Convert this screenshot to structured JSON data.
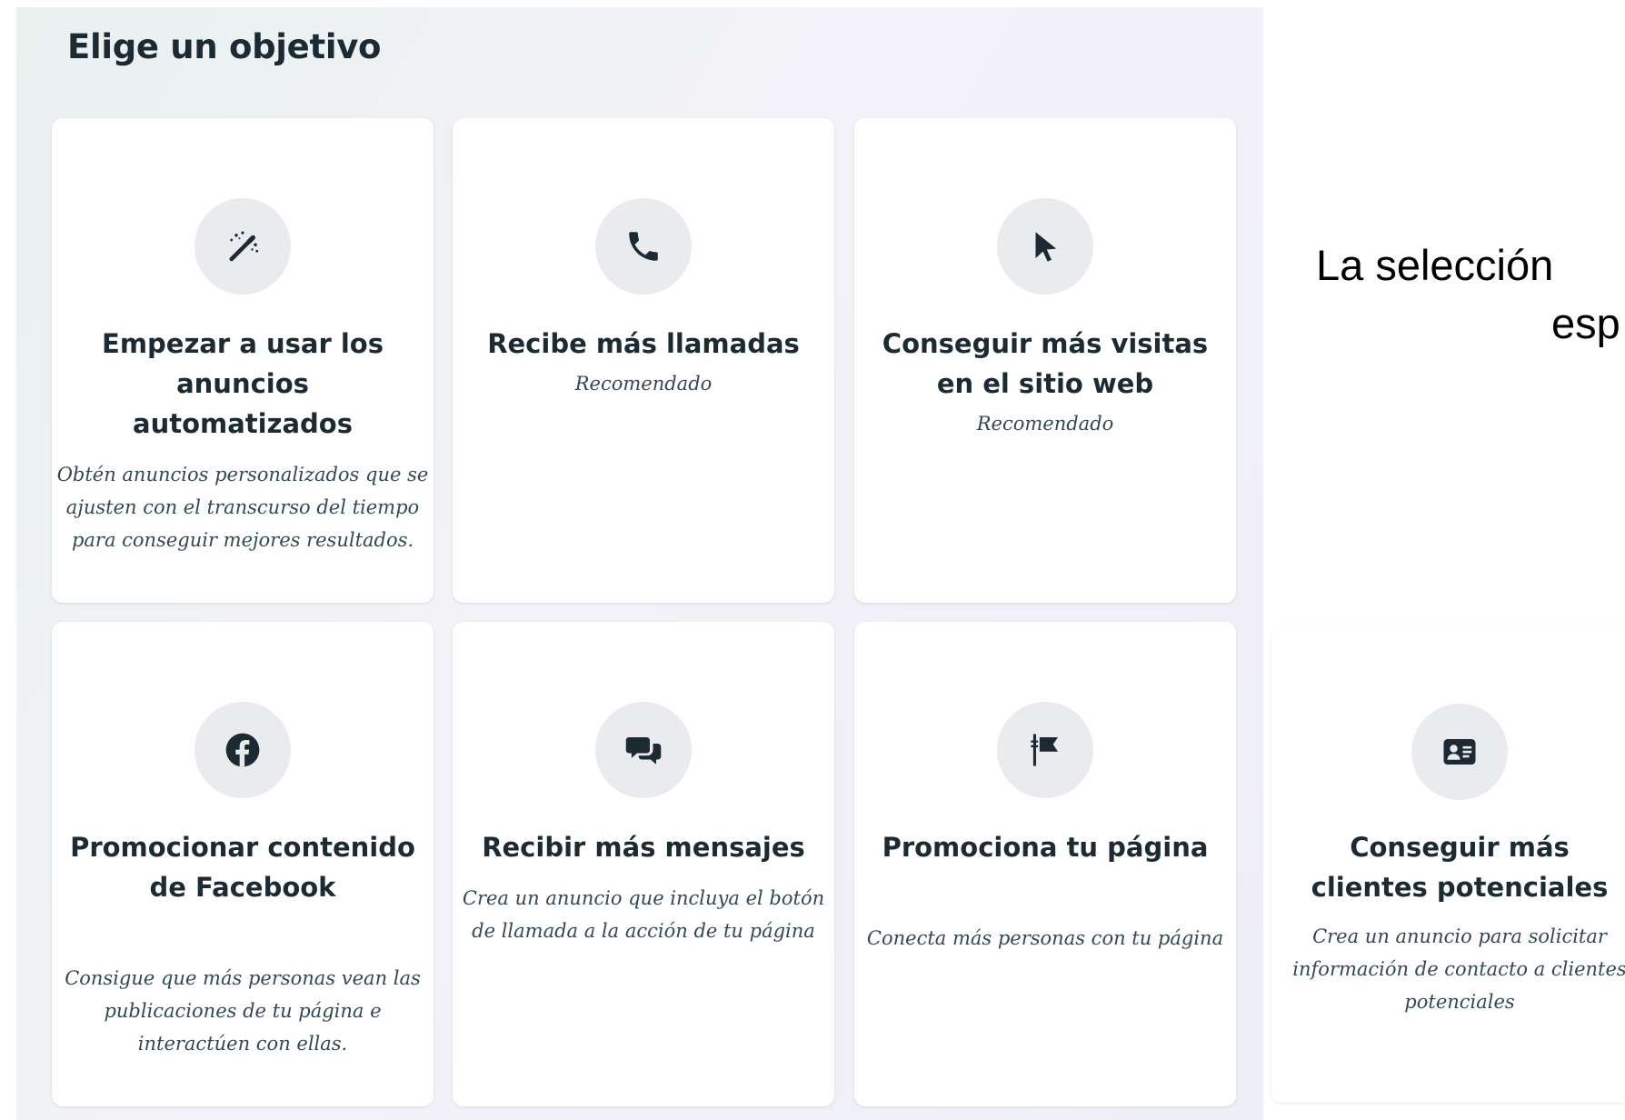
{
  "header": {
    "title": "Elige un objetivo"
  },
  "objectives": [
    {
      "title": "Empezar a usar los anuncios automatizados",
      "description": "Obtén anuncios personalizados que se ajusten con el transcurso del tiempo para conseguir mejores resultados.",
      "icon": "magic-wand-icon"
    },
    {
      "title": "Recibe más llamadas",
      "description": "Recomendado",
      "icon": "phone-icon"
    },
    {
      "title": "Conseguir más visitas en el sitio web",
      "description": "Recomendado",
      "icon": "cursor-icon"
    },
    {
      "title": "Promocionar contenido de Facebook",
      "description": "Consigue que más personas vean las publicaciones de tu página e interactúen con ellas.",
      "icon": "facebook-icon"
    },
    {
      "title": "Recibir más mensajes",
      "description": "Crea un anuncio que incluya el botón de llamada a la acción de tu página",
      "icon": "chat-bubbles-icon"
    },
    {
      "title": "Promociona tu página",
      "description": "Conecta más personas con tu página",
      "icon": "flag-icon"
    },
    {
      "title": "Conseguir más clientes potenciales",
      "description": "Crea un anuncio para solicitar información de contacto a clientes potenciales",
      "icon": "contact-card-icon"
    }
  ],
  "side_note": {
    "line1": "La selección",
    "line2": "esp"
  },
  "colors": {
    "title_text": "#1c2b33",
    "description_text": "#344854",
    "icon_background": "#e9ebef",
    "icon_glyph": "#1c2b33"
  }
}
